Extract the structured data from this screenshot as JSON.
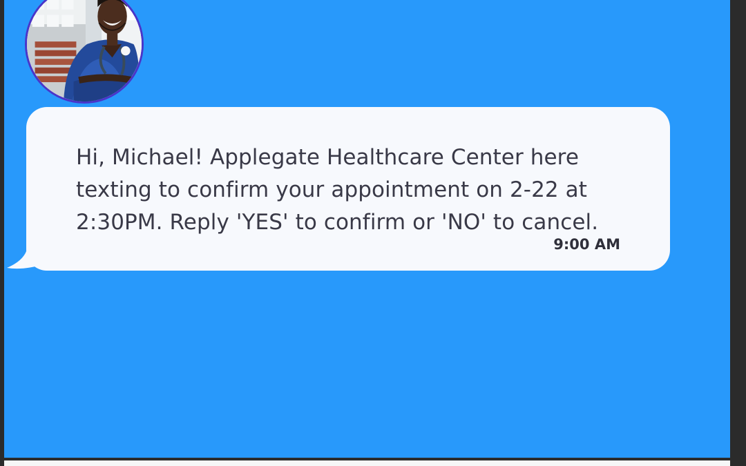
{
  "colors": {
    "panel": "#2899fb",
    "bubble": "#f7f9fd",
    "avatar_ring": "#4a35c9",
    "text": "#393947"
  },
  "avatar": {
    "icon": "doctor-avatar-icon"
  },
  "message": {
    "text": "Hi, Michael! Applegate Healthcare Center here\ntexting to confirm your appointment on 2-22 at\n2:30PM. Reply 'YES' to confirm or 'NO' to cancel.",
    "time": "9:00 AM"
  }
}
